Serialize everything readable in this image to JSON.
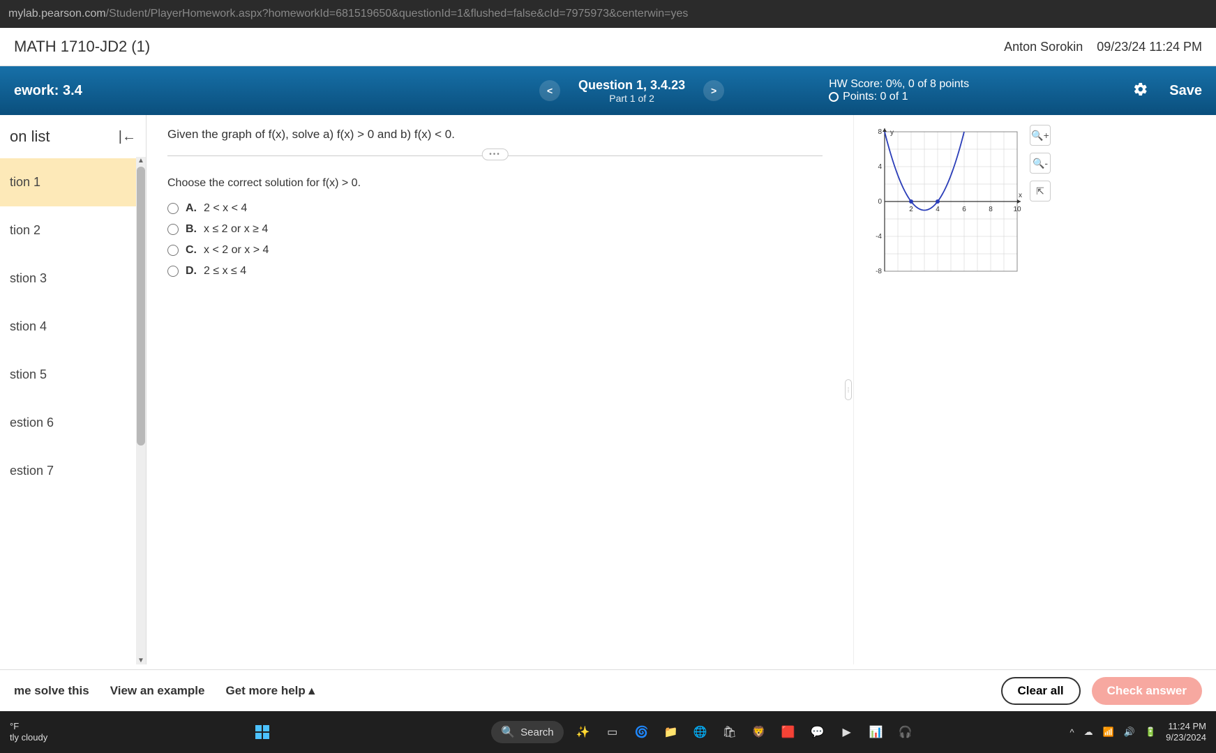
{
  "url": {
    "host": "mylab.pearson.com",
    "path": "/Student/PlayerHomework.aspx?homeworkId=681519650&questionId=1&flushed=false&cId=7975973&centerwin=yes"
  },
  "course": "MATH 1710-JD2 (1)",
  "user": "Anton Sorokin",
  "datetime": "09/23/24 11:24 PM",
  "hw_label": "ework: 3.4",
  "question_title": "Question 1, 3.4.23",
  "question_part": "Part 1 of 2",
  "hw_score": "HW Score: 0%, 0 of 8 points",
  "points": "Points: 0 of 1",
  "save_label": "Save",
  "sidebar_title": "on list",
  "sidebar_items": [
    "tion 1",
    "tion 2",
    "stion 3",
    "stion 4",
    "stion 5",
    "estion 6",
    "estion 7"
  ],
  "prompt": "Given the graph of f(x), solve a) f(x) > 0 and b) f(x) < 0.",
  "sub_prompt": "Choose the correct solution for f(x) > 0.",
  "choices": [
    {
      "letter": "A.",
      "text": "2 < x < 4"
    },
    {
      "letter": "B.",
      "text": "x ≤ 2 or x ≥ 4"
    },
    {
      "letter": "C.",
      "text": "x < 2 or x > 4"
    },
    {
      "letter": "D.",
      "text": "2 ≤ x ≤ 4"
    }
  ],
  "footer": {
    "solve": "me solve this",
    "example": "View an example",
    "help": "Get more help",
    "clear": "Clear all",
    "check": "Check answer"
  },
  "taskbar": {
    "weather_line1": "°F",
    "weather_line2": "tly cloudy",
    "search": "Search",
    "time": "11:24 PM",
    "date": "9/23/2024"
  },
  "chart_data": {
    "type": "line",
    "title": "",
    "xlabel": "x",
    "ylabel": "y",
    "xlim": [
      0,
      10
    ],
    "ylim": [
      -8,
      8
    ],
    "xticks": [
      2,
      4,
      6,
      8,
      10
    ],
    "yticks": [
      -8,
      -4,
      0,
      4,
      8
    ],
    "series": [
      {
        "name": "f(x)",
        "x": [
          0,
          1,
          2,
          3,
          4,
          5,
          6
        ],
        "y": [
          8,
          3,
          0,
          -1,
          0,
          3,
          8
        ]
      }
    ],
    "roots": [
      2,
      4
    ],
    "vertex": {
      "x": 3,
      "y": -1
    }
  }
}
